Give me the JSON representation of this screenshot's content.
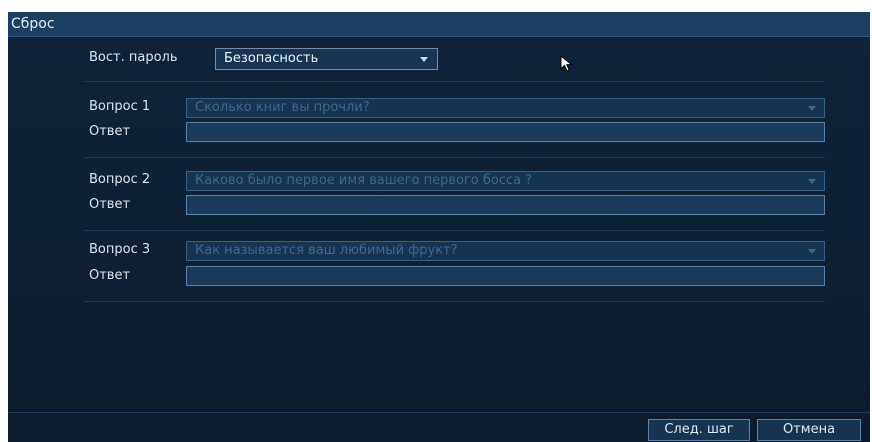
{
  "dialog": {
    "title": "Сброс"
  },
  "recovery": {
    "label": "Вост. пароль",
    "selected": "Безопасность"
  },
  "questions": [
    {
      "label": "Вопрос 1",
      "question": "Сколько книг вы прочли?",
      "answer_label": "Ответ",
      "answer": ""
    },
    {
      "label": "Вопрос 2",
      "question": "Каково было первое имя вашего первого босса ?",
      "answer_label": "Ответ",
      "answer": ""
    },
    {
      "label": "Вопрос 3",
      "question": "Как называется ваш любимый фрукт?",
      "answer_label": "Ответ",
      "answer": ""
    }
  ],
  "buttons": {
    "next": "След. шаг",
    "cancel": "Отмена"
  },
  "colors": {
    "background": "#102338",
    "titlebar": "#1c3f62",
    "border": "#5f82a6",
    "disabled_text": "#3f6790"
  },
  "icons": {
    "dropdown": "chevron-down-icon",
    "cursor": "mouse-pointer-icon"
  }
}
